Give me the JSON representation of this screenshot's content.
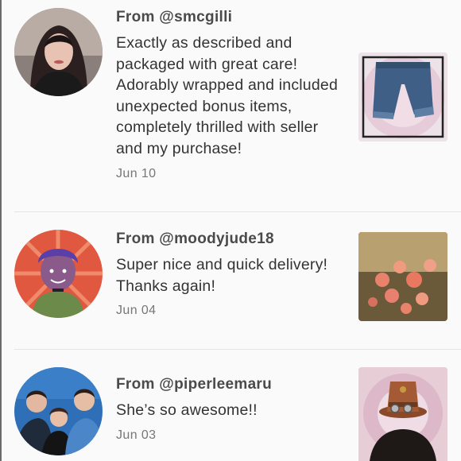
{
  "reviews": [
    {
      "from": "From @smcgilli",
      "text": "Exactly as described and packaged with great care! Adorably wrapped and included unexpected bonus items, completely thrilled with seller and my purchase!",
      "date": "Jun 10",
      "avatar_icon": "user-photo",
      "thumb_icon": "cropped-jeans-photo"
    },
    {
      "from": "From @moodyjude18",
      "text": "Super nice and quick delivery! Thanks again!",
      "date": "Jun 04",
      "avatar_icon": "cartoon-avatar",
      "thumb_icon": "flowers-photo"
    },
    {
      "from": "From @piperleemaru",
      "text": "She’s so awesome!!",
      "date": "Jun 03",
      "avatar_icon": "group-photo",
      "thumb_icon": "steampunk-hat-photo"
    }
  ],
  "colors": {
    "background": "#fbfafb",
    "username": "#4a4a4a",
    "body_text": "#333333",
    "date": "#777777",
    "divider": "#e6e3e6"
  }
}
